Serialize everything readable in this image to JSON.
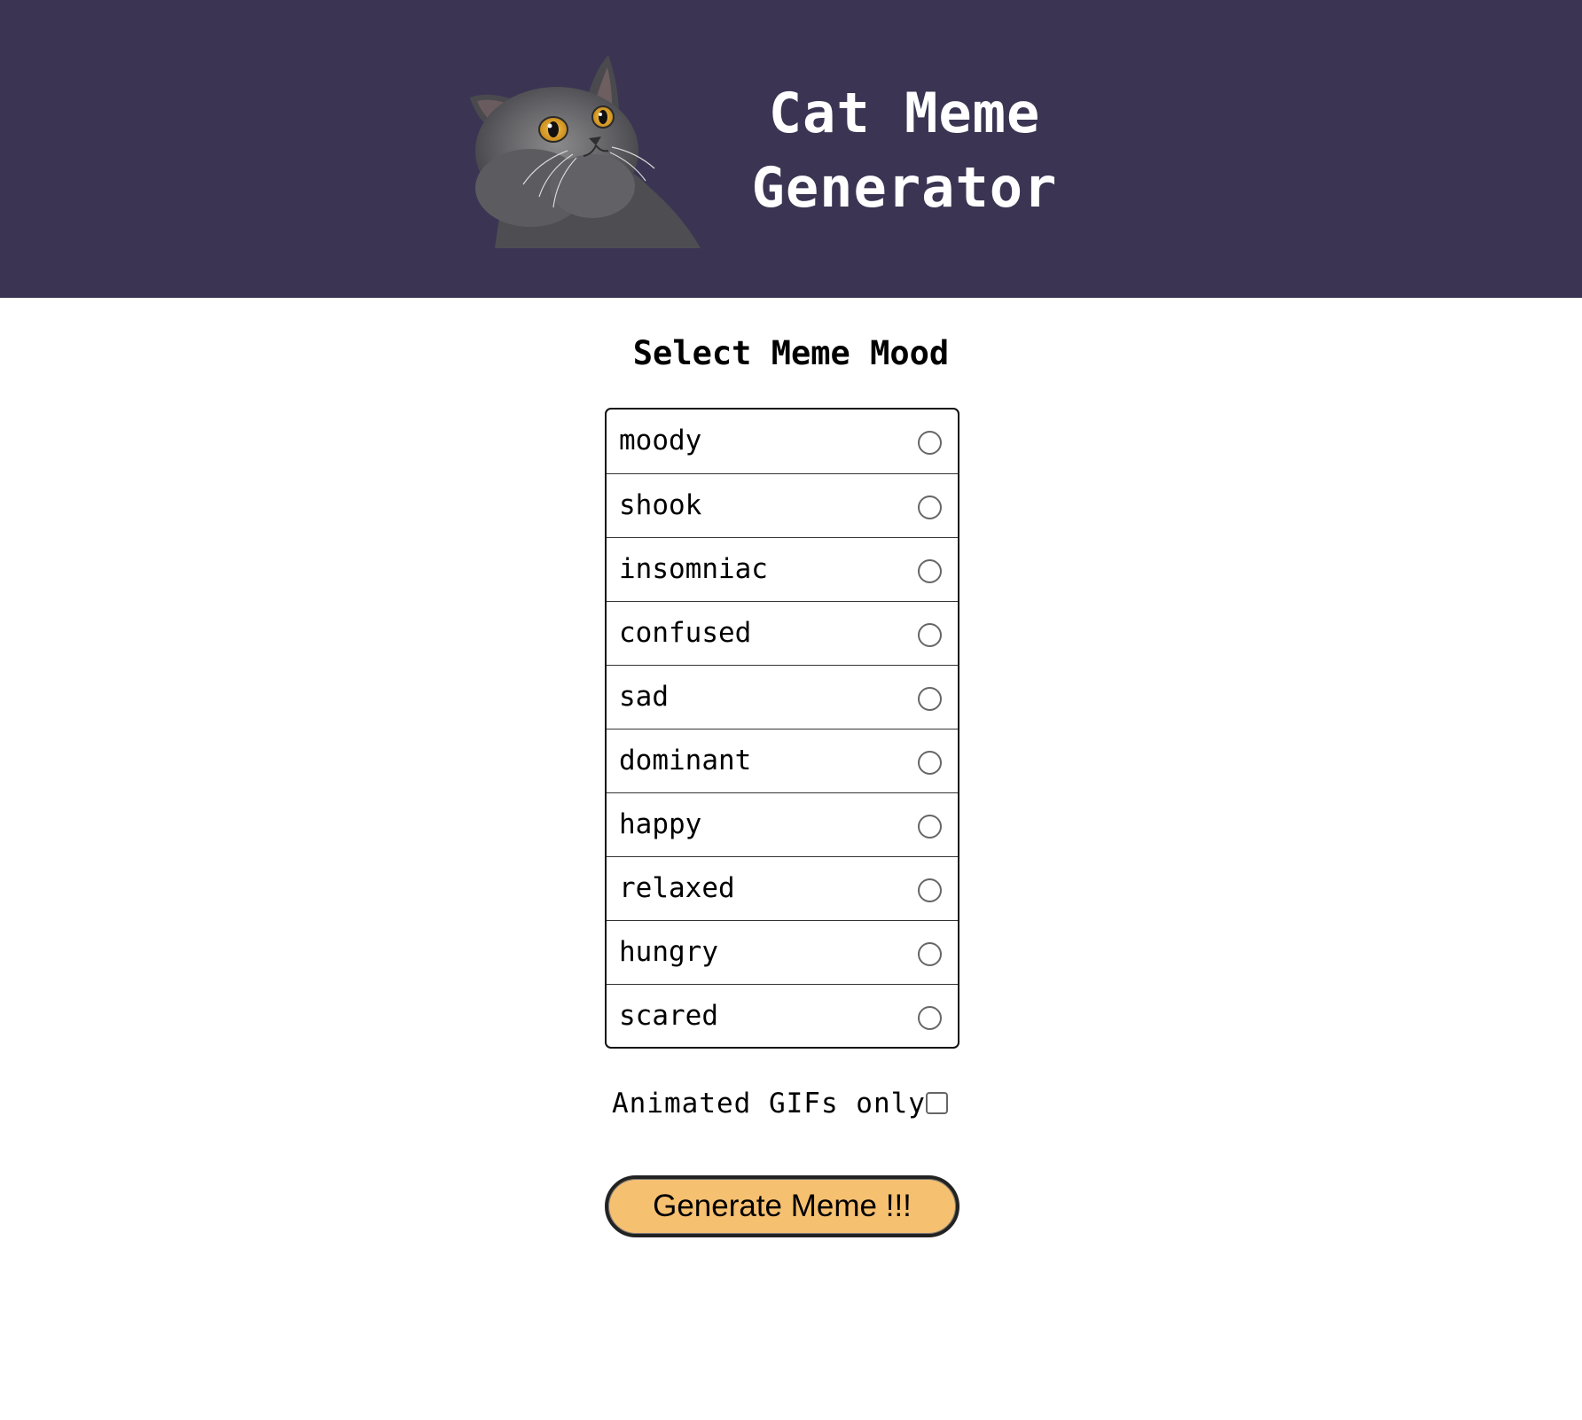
{
  "colors": {
    "header_background": "#3b3553",
    "button_background": "#f6c071"
  },
  "header": {
    "logo_icon": "shocked-cat-icon",
    "title_line1": "Cat Meme",
    "title_line2": "Generator"
  },
  "mood_selector": {
    "heading": "Select Meme Mood",
    "options": [
      {
        "label": "moody",
        "selected": false
      },
      {
        "label": "shook",
        "selected": false
      },
      {
        "label": "insomniac",
        "selected": false
      },
      {
        "label": "confused",
        "selected": false
      },
      {
        "label": "sad",
        "selected": false
      },
      {
        "label": "dominant",
        "selected": false
      },
      {
        "label": "happy",
        "selected": false
      },
      {
        "label": "relaxed",
        "selected": false
      },
      {
        "label": "hungry",
        "selected": false
      },
      {
        "label": "scared",
        "selected": false
      }
    ]
  },
  "gif_filter": {
    "label": "Animated GIFs only",
    "checked": false
  },
  "generate_button": {
    "label": "Generate Meme !!!"
  }
}
